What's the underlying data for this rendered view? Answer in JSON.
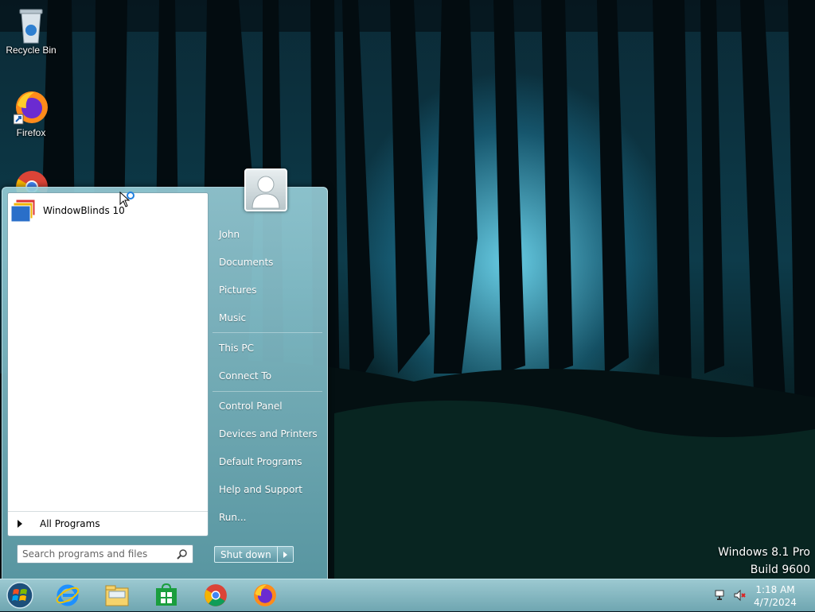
{
  "desktop": {
    "icons": [
      {
        "label": "Recycle Bin",
        "icon": "recycle-bin-icon"
      },
      {
        "label": "Firefox",
        "icon": "firefox-icon"
      },
      {
        "label": "",
        "icon": "chrome-icon"
      }
    ]
  },
  "start_menu": {
    "programs": [
      {
        "label": "WindowBlinds 10",
        "icon": "windowblinds-icon"
      }
    ],
    "all_programs_label": "All Programs",
    "search_placeholder": "Search programs and files",
    "right_items": [
      {
        "label": "John"
      },
      {
        "label": "Documents"
      },
      {
        "label": "Pictures"
      },
      {
        "label": "Music"
      },
      {
        "label": "This PC"
      },
      {
        "label": "Connect To"
      },
      {
        "label": "Control Panel"
      },
      {
        "label": "Devices and Printers"
      },
      {
        "label": "Default Programs"
      },
      {
        "label": "Help and Support"
      },
      {
        "label": "Run..."
      }
    ],
    "shutdown_label": "Shut down"
  },
  "watermark": {
    "line1": "Windows 8.1 Pro",
    "line2": "Build 9600"
  },
  "taskbar": {
    "pinned": [
      "internet-explorer-icon",
      "file-explorer-icon",
      "store-icon",
      "chrome-icon",
      "firefox-icon"
    ],
    "clock_time": "1:18 AM",
    "clock_date": "4/7/2024"
  },
  "colors": {
    "taskbar": "#7fb3bd",
    "start_menu": "#7fb8c2"
  }
}
